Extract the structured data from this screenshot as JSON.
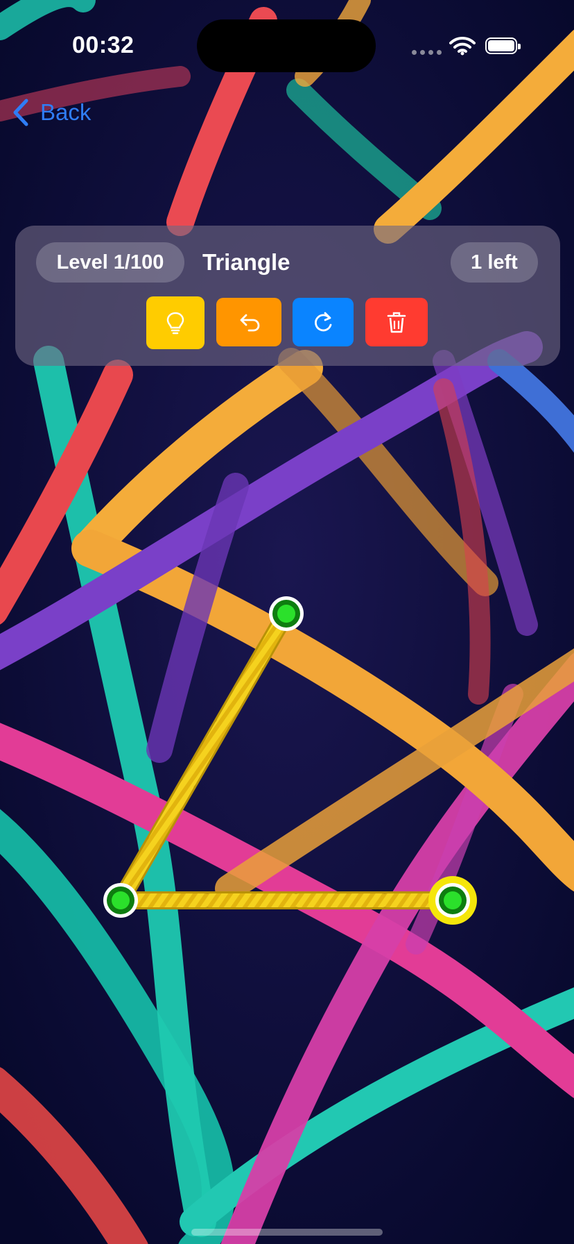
{
  "status_bar": {
    "time": "00:32",
    "wifi_icon": "wifi-icon",
    "battery_icon": "battery-icon"
  },
  "nav": {
    "back_label": "Back",
    "back_icon": "chevron-left-icon"
  },
  "hud": {
    "level_label": "Level 1/100",
    "level_name": "Triangle",
    "remaining_label": "1 left",
    "buttons": [
      {
        "name": "hint-button",
        "icon": "lightbulb-icon",
        "color": "#ffcc00"
      },
      {
        "name": "undo-button",
        "icon": "undo-arrow-icon",
        "color": "#ff9500"
      },
      {
        "name": "redo-button",
        "icon": "redo-arrow-icon",
        "color": "#0a84ff"
      },
      {
        "name": "clear-button",
        "icon": "trash-icon",
        "color": "#ff3b30"
      }
    ]
  },
  "puzzle": {
    "shape": "triangle",
    "nodes": [
      "top-node",
      "left-node",
      "right-node"
    ],
    "active_node": "right-node",
    "node_color": "#1fd31f",
    "segment_color": "#f5d21e",
    "segments_drawn": 2,
    "segments_total": 3
  },
  "background": {
    "theme": "colorful-ropes",
    "rope_colors": [
      "#f4ac3a",
      "#e53f8f",
      "#1fc9b0",
      "#7b3fc6",
      "#e84a4a",
      "#3f6fd6"
    ]
  }
}
